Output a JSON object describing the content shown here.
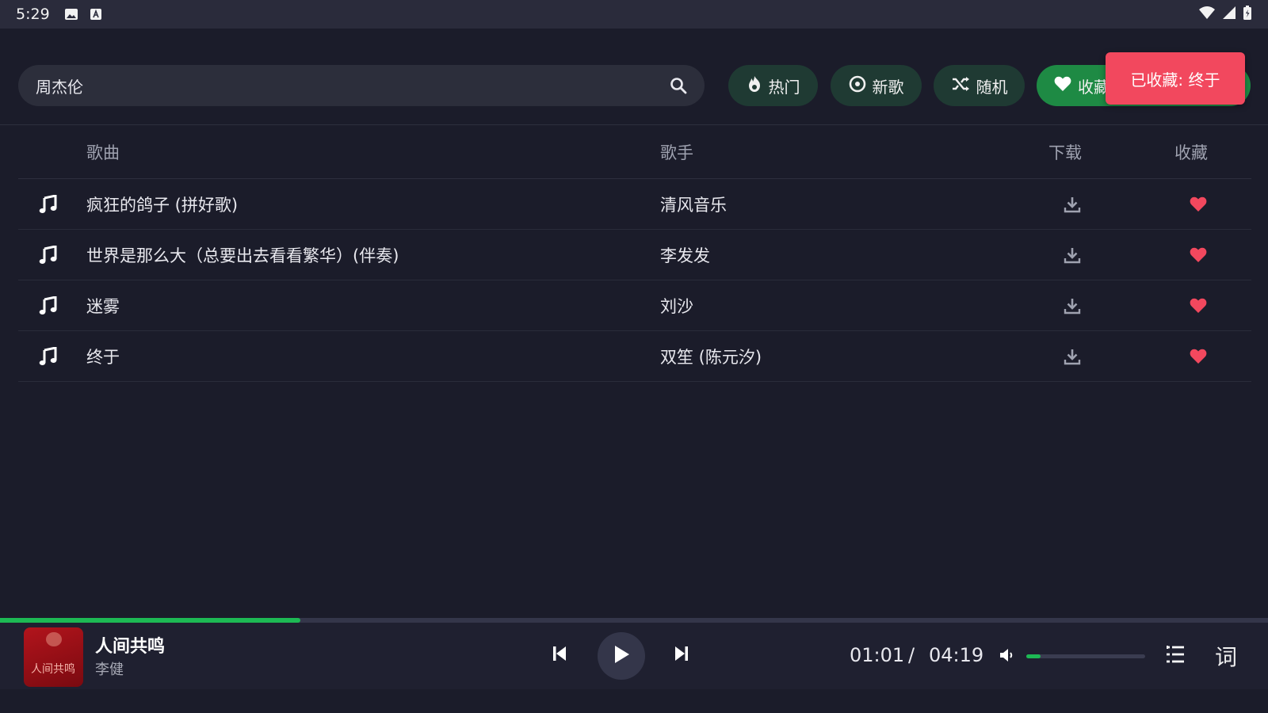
{
  "status_bar": {
    "time": "5:29",
    "icons": [
      "image-icon",
      "keyboard-a-icon",
      "wifi-icon",
      "cell-signal-icon",
      "battery-icon"
    ]
  },
  "search": {
    "value": "周杰伦",
    "icon": "search-icon"
  },
  "chips": {
    "hot": "热门",
    "new": "新歌",
    "random": "随机",
    "favorites": "收藏"
  },
  "toast": "已收藏: 终于",
  "table": {
    "headers": {
      "song": "歌曲",
      "artist": "歌手",
      "download": "下载",
      "favorite": "收藏"
    },
    "rows": [
      {
        "song": "疯狂的鸽子 (拼好歌)",
        "artist": "清风音乐",
        "favorited": true
      },
      {
        "song": "世界是那么大（总要出去看看繁华）(伴奏)",
        "artist": "李发发",
        "favorited": true
      },
      {
        "song": "迷雾",
        "artist": "刘沙",
        "favorited": true
      },
      {
        "song": "终于",
        "artist": "双笙 (陈元汐)",
        "favorited": true
      }
    ]
  },
  "player": {
    "title": "人间共鸣",
    "artist": "李健",
    "cover_text": "人间共鸣",
    "current_time": "01:01",
    "separator": "/",
    "total_time": "04:19",
    "progress_fraction": 0.237,
    "volume_fraction": 0.12,
    "lyrics_label": "词"
  },
  "colors": {
    "background": "#1b1c2a",
    "accent_green": "#1db954",
    "favorite_red": "#f2485e",
    "chip_bg": "#1f3a33"
  }
}
